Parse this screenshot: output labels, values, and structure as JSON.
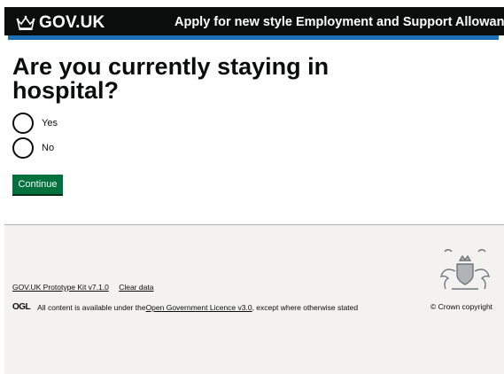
{
  "header": {
    "logo_text": "GOV.UK",
    "service_name": "Apply for new style Employment and Support Allowance"
  },
  "question": {
    "title": "Are you currently staying in hospital?"
  },
  "options": [
    {
      "label": "Yes",
      "selected": false
    },
    {
      "label": "No",
      "selected": false
    }
  ],
  "continue_label": "Continue",
  "footer": {
    "prototype_link": "GOV.UK Prototype Kit v7.1.0",
    "clear_data_link": "Clear data",
    "ogl_logo": "OGL",
    "licence_prefix": "All content is available under the ",
    "licence_link": "Open Government Licence v3.0",
    "licence_suffix": ", except where otherwise stated",
    "copyright": "© Crown copyright"
  },
  "colors": {
    "header_bg": "#0b0c0c",
    "header_bar": "#1d70b8",
    "button_green": "#00703c",
    "footer_bg": "#f3f2f1"
  },
  "icons": {
    "logo": "crown-icon",
    "footer_crest": "royal-coat-of-arms-icon"
  }
}
